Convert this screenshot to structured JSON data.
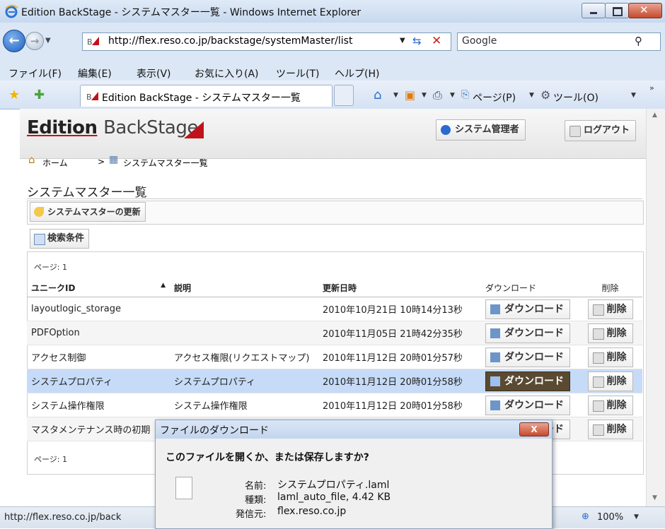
{
  "browser": {
    "window_title": "Edition BackStage - システムマスター一覧 - Windows Internet Explorer",
    "url": "http://flex.reso.co.jp/backstage/systemMaster/list",
    "search_placeholder": "Google",
    "menu": [
      "ファイル(F)",
      "編集(E)",
      "表示(V)",
      "お気に入り(A)",
      "ツール(T)",
      "ヘルプ(H)"
    ],
    "tab_title": "Edition BackStage - システムマスター一覧",
    "toolbar": {
      "page": "ページ(P)",
      "tools": "ツール(O)"
    },
    "status_url": "http://flex.reso.co.jp/back",
    "zoom": "100%"
  },
  "app": {
    "brand_main": "Edition",
    "brand_sub": "BackStage",
    "user_button": "システム管理者",
    "logout_button": "ログアウト",
    "breadcrumb": {
      "home": "ホーム",
      "separator": ">",
      "current": "システムマスター一覧"
    },
    "page_title": "システムマスター一覧",
    "update_button": "システムマスターの更新",
    "search_button": "検索条件",
    "page_info": "ページ: 1",
    "table": {
      "headers": {
        "id": "ユニークID",
        "sort": "▲",
        "desc": "説明",
        "updated": "更新日時",
        "download": "ダウンロード",
        "delete": "削除"
      },
      "download_label": "ダウンロード",
      "delete_label": "削除",
      "rows": [
        {
          "id": "layoutlogic_storage",
          "desc": "",
          "updated": "2010年10月21日 10時14分13秒"
        },
        {
          "id": "PDFOption",
          "desc": "",
          "updated": "2010年11月05日 21時42分35秒"
        },
        {
          "id": "アクセス制御",
          "desc": "アクセス権限(リクエストマップ)",
          "updated": "2010年11月12日 20時01分57秒"
        },
        {
          "id": "システムプロパティ",
          "desc": "システムプロパティ",
          "updated": "2010年11月12日 20時01分58秒"
        },
        {
          "id": "システム操作権限",
          "desc": "システム操作権限",
          "updated": "2010年11月12日 20時01分58秒"
        },
        {
          "id": "マスタメンテナンス時の初期",
          "desc": "",
          "updated": ""
        }
      ]
    }
  },
  "dialog": {
    "title": "ファイルのダウンロード",
    "question": "このファイルを開くか、または保存しますか?",
    "name_label": "名前:",
    "name_value": "システムプロパティ.laml",
    "type_label": "種類:",
    "type_value": "laml_auto_file, 4.42 KB",
    "from_label": "発信元:",
    "from_value": "flex.reso.co.jp",
    "close_glyph": "X"
  },
  "colors": {
    "brand_red": "#c0121a",
    "selected_row": "#c6dbf7",
    "active_download": "#5a4a32"
  }
}
